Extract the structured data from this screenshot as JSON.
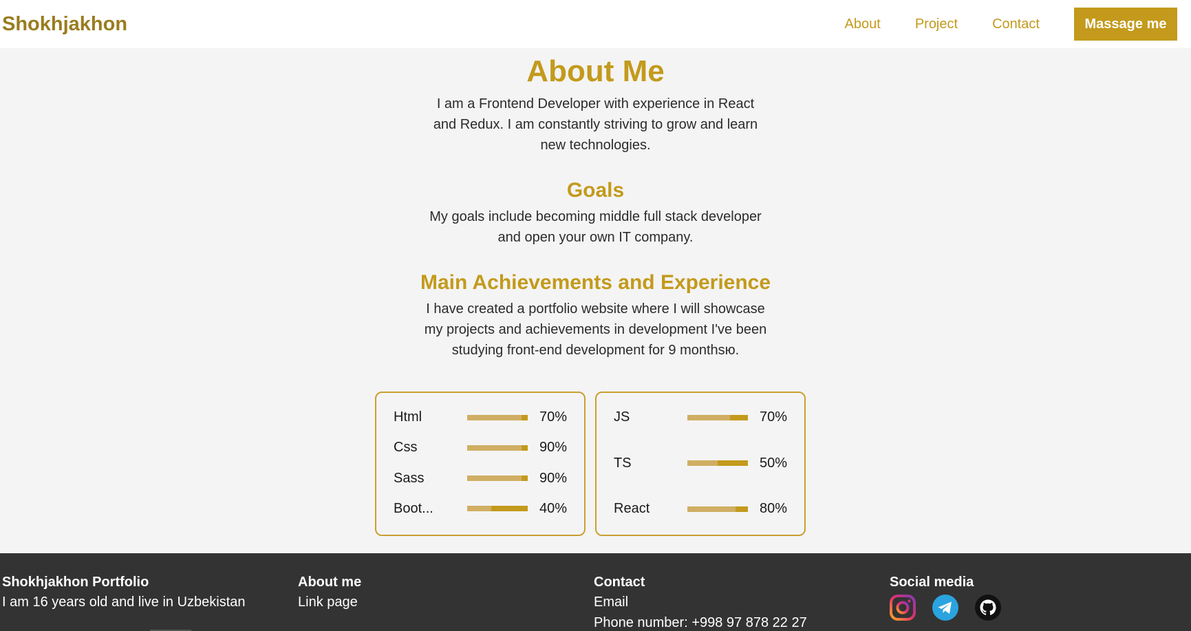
{
  "header": {
    "brand": "Shokhjakhon",
    "nav": [
      "About",
      "Project",
      "Contact"
    ],
    "cta": "Massage me"
  },
  "about": {
    "title": "About Me",
    "text": "I am a Frontend Developer with experience in React and Redux. I am constantly striving to grow and learn new technologies."
  },
  "goals": {
    "title": "Goals",
    "text": "My goals include becoming middle full stack developer and open your own IT company."
  },
  "achievements": {
    "title": "Main Achievements and Experience",
    "text": "I have created a portfolio website where I will showcase my projects and achievements in development I've been studying front-end development for 9 monthsю."
  },
  "skills": {
    "left": [
      {
        "name": "Html",
        "percent": "70%",
        "level": 0.9
      },
      {
        "name": "Css",
        "percent": "90%",
        "level": 0.9
      },
      {
        "name": "Sass",
        "percent": "90%",
        "level": 0.9
      },
      {
        "name": "Boot...",
        "percent": "40%",
        "level": 0.4
      }
    ],
    "right": [
      {
        "name": "JS",
        "percent": "70%",
        "level": 0.7
      },
      {
        "name": "TS",
        "percent": "50%",
        "level": 0.5
      },
      {
        "name": "React",
        "percent": "80%",
        "level": 0.8
      }
    ]
  },
  "footer": {
    "portfolio_title": "Shokhjakhon Portfolio",
    "portfolio_text": "I am 16 years old and live in Uzbekistan",
    "about_title": "About me",
    "about_link": "Link page",
    "contact_title": "Contact",
    "contact_email": "Email",
    "contact_phone": "Phone number: +998 97 878 22 27",
    "social_title": "Social media",
    "social_icons": [
      "instagram-icon",
      "telegram-icon",
      "github-icon"
    ]
  },
  "colors": {
    "accent": "#c39a1c",
    "brand": "#9a7c1f",
    "bar_light": "#d0ae63",
    "footer_bg": "#333333",
    "page_bg": "#f4f4f4"
  }
}
